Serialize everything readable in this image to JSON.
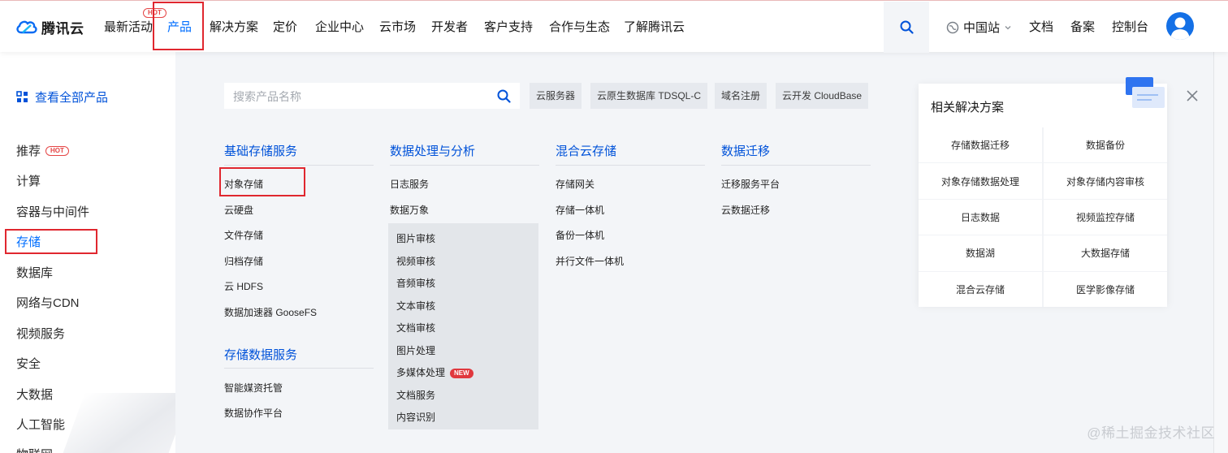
{
  "brand": {
    "name": "腾讯云"
  },
  "nav": {
    "items": [
      "最新活动",
      "产品",
      "解决方案",
      "定价",
      "企业中心",
      "云市场",
      "开发者",
      "客户支持",
      "合作与生态",
      "了解腾讯云"
    ],
    "hot_badge": "HOT",
    "region": "中国站",
    "docs": "文档",
    "record": "备案",
    "console": "控制台"
  },
  "sidebar": {
    "all_products": "查看全部产品",
    "hot_badge": "HOT",
    "categories": [
      "推荐",
      "计算",
      "容器与中间件",
      "存储",
      "数据库",
      "网络与CDN",
      "视频服务",
      "安全",
      "大数据",
      "人工智能",
      "物联网"
    ]
  },
  "search": {
    "placeholder": "搜索产品名称",
    "chips": [
      "云服务器",
      "云原生数据库 TDSQL-C",
      "域名注册",
      "云开发 CloudBase"
    ]
  },
  "columns": [
    {
      "title": "基础存储服务",
      "items": [
        "对象存储",
        "云硬盘",
        "文件存储",
        "归档存储",
        "云 HDFS",
        "数据加速器 GooseFS"
      ]
    },
    {
      "title": "数据处理与分析",
      "items": [
        "日志服务",
        "数据万象"
      ],
      "subitems": [
        "图片审核",
        "视频审核",
        "音频审核",
        "文本审核",
        "文档审核",
        "图片处理",
        "多媒体处理",
        "文档服务",
        "内容识别"
      ],
      "new_badge": "NEW"
    },
    {
      "title": "混合云存储",
      "items": [
        "存储网关",
        "存储一体机",
        "备份一体机",
        "并行文件一体机"
      ]
    },
    {
      "title": "数据迁移",
      "items": [
        "迁移服务平台",
        "云数据迁移"
      ]
    },
    {
      "title": "存储数据服务",
      "items": [
        "智能媒资托管",
        "数据协作平台"
      ]
    }
  ],
  "solutions": {
    "title": "相关解决方案",
    "items": [
      "存储数据迁移",
      "数据备份",
      "对象存储数据处理",
      "对象存储内容审核",
      "日志数据",
      "视频监控存储",
      "数据湖",
      "大数据存储",
      "混合云存储",
      "医学影像存储"
    ]
  },
  "watermark": "@稀土掘金技术社区",
  "colors": {
    "accent": "#006eff",
    "link_blue": "#0052d9",
    "hot_red": "#e54545",
    "annotation_red": "#e0272f"
  }
}
